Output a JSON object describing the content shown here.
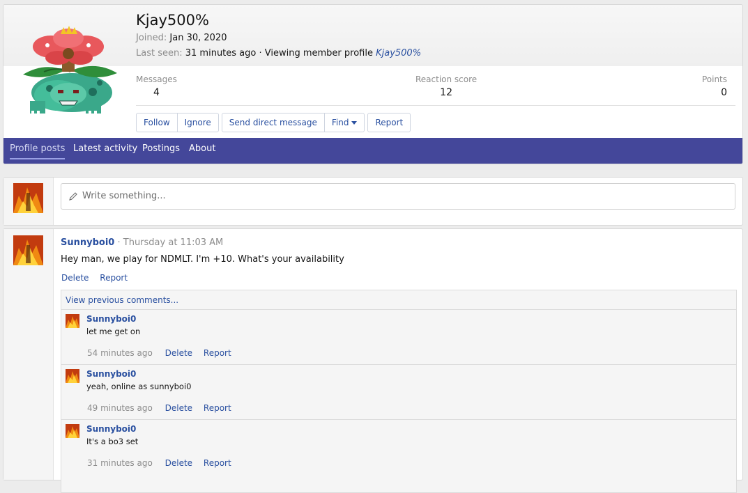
{
  "profile": {
    "username": "Kjay500%",
    "joined_label": "Joined:",
    "joined_value": "Jan 30, 2020",
    "last_seen_label": "Last seen:",
    "last_seen_value": "31 minutes ago · Viewing member profile",
    "last_seen_link": "Kjay500%",
    "stats": {
      "messages_label": "Messages",
      "messages_value": "4",
      "reaction_label": "Reaction score",
      "reaction_value": "12",
      "points_label": "Points",
      "points_value": "0"
    },
    "buttons": {
      "follow": "Follow",
      "ignore": "Ignore",
      "send_dm": "Send direct message",
      "find": "Find",
      "report": "Report"
    }
  },
  "tabs": [
    {
      "label": "Profile posts",
      "active": true
    },
    {
      "label": "Latest activity",
      "active": false
    },
    {
      "label": "Postings",
      "active": false
    },
    {
      "label": "About",
      "active": false
    }
  ],
  "composer": {
    "placeholder": "Write something..."
  },
  "post": {
    "author": "Sunnyboi0",
    "separator": "·",
    "time": "Thursday at 11:03 AM",
    "body": "Hey man, we play for NDMLT. I'm +10. What's your availability",
    "delete_label": "Delete",
    "report_label": "Report"
  },
  "comments_section": {
    "view_previous": "View previous comments...",
    "comments": [
      {
        "author": "Sunnyboi0",
        "body": "let me get on",
        "time": "54 minutes ago",
        "delete": "Delete",
        "report": "Report"
      },
      {
        "author": "Sunnyboi0",
        "body": "yeah, online as sunnyboi0",
        "time": "49 minutes ago",
        "delete": "Delete",
        "report": "Report"
      },
      {
        "author": "Sunnyboi0",
        "body": "It's a bo3 set",
        "time": "31 minutes ago",
        "delete": "Delete",
        "report": "Report"
      }
    ]
  },
  "colors": {
    "tab_bar": "#44479a",
    "link": "#2a50a0"
  },
  "icons": {
    "profile_avatar": "venusaur-pixel-avatar",
    "user_avatar": "flame-avatar",
    "composer_icon": "pencil-icon",
    "find_caret": "caret-down-icon"
  }
}
